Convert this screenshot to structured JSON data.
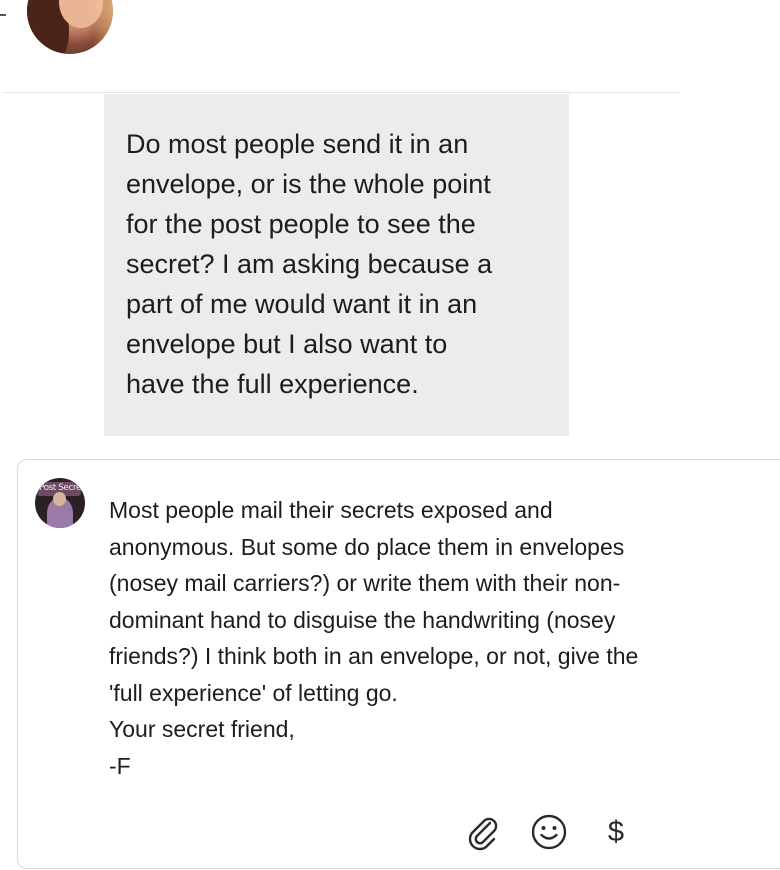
{
  "top_avatar": {
    "name": "user-avatar"
  },
  "user_message": {
    "text": "Do most people send it in an\nenvelope, or is the whole point\nfor the post people to see the\nsecret? I am asking because a\npart of me would want it in an\nenvelope but I also want to\nhave the full experience."
  },
  "reply": {
    "avatar_sign_text": "Post Secret",
    "text": "Most people mail their secrets exposed and\nanonymous. But some do place them in envelopes\n(nosey mail carriers?) or write them with their non-\ndominant hand to disguise the handwriting (nosey\nfriends?) I think both in an envelope, or not, give the\n'full experience' of letting go.\nYour secret friend,\n-F"
  },
  "actions": {
    "attach_icon": "paperclip-icon",
    "emoji_icon": "smiley-icon",
    "tip_label": "$"
  },
  "colors": {
    "bubble_bg": "#ececec",
    "card_border": "#d8d8d8",
    "text": "#1d1d1d"
  }
}
